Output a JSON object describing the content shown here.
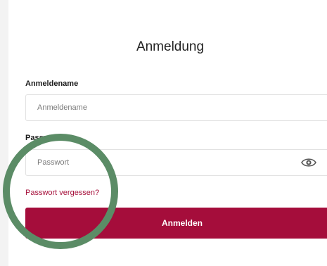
{
  "form": {
    "title": "Anmeldung",
    "username_label": "Anmeldename",
    "username_placeholder": "Anmeldename",
    "password_label": "Passwort",
    "password_placeholder": "Passwort",
    "forgot_link": "Passwort vergessen?",
    "submit_label": "Anmelden"
  },
  "icons": {
    "password_toggle": "eye-icon"
  },
  "colors": {
    "accent": "#a50d3b",
    "link": "#a6103b",
    "highlight_circle": "#5b8c66",
    "page_background": "#f3f3f3"
  }
}
